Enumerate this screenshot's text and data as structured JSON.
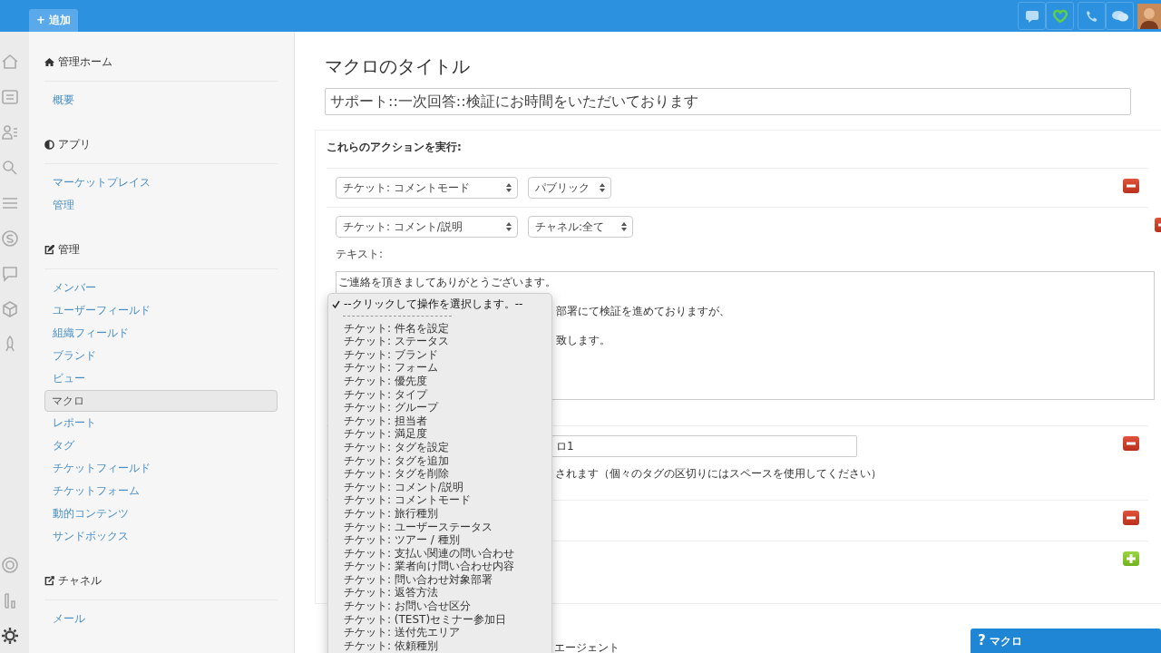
{
  "topbar": {
    "add_button": "+ 追加",
    "icons": [
      {
        "kind": "chat",
        "selected": false
      },
      {
        "kind": "heart",
        "selected": true
      },
      {
        "kind": "phone",
        "selected": false
      },
      {
        "kind": "bubbles",
        "selected": false
      }
    ]
  },
  "rail_top": [
    {
      "kind": "home"
    },
    {
      "kind": "doc"
    },
    {
      "kind": "users"
    },
    {
      "kind": "search"
    },
    {
      "kind": "lines"
    },
    {
      "kind": "s"
    },
    {
      "kind": "chat"
    },
    {
      "kind": "cube"
    },
    {
      "kind": "rocket"
    }
  ],
  "rail_bottom": [
    {
      "kind": "buoy"
    },
    {
      "kind": "bars"
    },
    {
      "kind": "gear"
    }
  ],
  "sidebar": [
    {
      "kind": "home",
      "title": "管理ホーム",
      "items": [
        {
          "label": "概要",
          "selected": false
        }
      ]
    },
    {
      "kind": "half",
      "title": "アプリ",
      "items": [
        {
          "label": "マーケットプレイス",
          "selected": false
        },
        {
          "label": "管理",
          "selected": false
        }
      ]
    },
    {
      "kind": "edit",
      "title": "管理",
      "items": [
        {
          "label": "メンバー",
          "selected": false
        },
        {
          "label": "ユーザーフィールド",
          "selected": false
        },
        {
          "label": "組織フィールド",
          "selected": false
        },
        {
          "label": "ブランド",
          "selected": false
        },
        {
          "label": "ビュー",
          "selected": false
        },
        {
          "label": "マクロ",
          "selected": true
        },
        {
          "label": "レポート",
          "selected": false
        },
        {
          "label": "タグ",
          "selected": false
        },
        {
          "label": "チケットフィールド",
          "selected": false
        },
        {
          "label": "チケットフォーム",
          "selected": false
        },
        {
          "label": "動的コンテンツ",
          "selected": false
        },
        {
          "label": "サンドボックス",
          "selected": false
        }
      ]
    },
    {
      "kind": "share",
      "title": "チャネル",
      "items": [
        {
          "label": "メール",
          "selected": false
        }
      ]
    }
  ],
  "main": {
    "title": "マクロのタイトル",
    "title_value": "サポート::一次回答::検証にお時間をいただいております",
    "actions_heading": "これらのアクションを実行:",
    "actions": [
      {
        "kind": "selects",
        "selects": [
          "チケット: コメントモード",
          "パブリック"
        ],
        "button": {
          "kind": "remove"
        }
      },
      {
        "kind": "comment",
        "selects": [
          "チケット: コメント/説明",
          "チャネル:全て"
        ],
        "text_label": "テキスト:",
        "first_line": "ご連絡を頂きましてありがとうございます。",
        "covered_lines": [
          "部署にて検証を進めておりますが、",
          "致します。"
        ],
        "button": {
          "kind": "remove"
        }
      },
      {
        "kind": "tags",
        "value": "ロ1",
        "hint": "されます（個々のタグの区切りにはスペースを使用してください）",
        "button": {
          "kind": "remove"
        }
      },
      {
        "kind": "empty",
        "button": {
          "kind": "remove"
        }
      },
      {
        "kind": "empty",
        "button": {
          "kind": "add"
        }
      }
    ],
    "footer_text": "エージェント"
  },
  "dropdown": {
    "items": [
      {
        "kind": "option",
        "label": "--クリックして操作を選択します。--",
        "selected": true
      },
      {
        "kind": "separator"
      },
      {
        "kind": "option",
        "label": "チケット: 件名を設定",
        "selected": false
      },
      {
        "kind": "option",
        "label": "チケット: ステータス",
        "selected": false
      },
      {
        "kind": "option",
        "label": "チケット: ブランド",
        "selected": false
      },
      {
        "kind": "option",
        "label": "チケット: フォーム",
        "selected": false
      },
      {
        "kind": "option",
        "label": "チケット: 優先度",
        "selected": false
      },
      {
        "kind": "option",
        "label": "チケット: タイプ",
        "selected": false
      },
      {
        "kind": "option",
        "label": "チケット: グループ",
        "selected": false
      },
      {
        "kind": "option",
        "label": "チケット: 担当者",
        "selected": false
      },
      {
        "kind": "option",
        "label": "チケット: 満足度",
        "selected": false
      },
      {
        "kind": "option",
        "label": "チケット: タグを設定",
        "selected": false
      },
      {
        "kind": "option",
        "label": "チケット: タグを追加",
        "selected": false
      },
      {
        "kind": "option",
        "label": "チケット: タグを削除",
        "selected": false
      },
      {
        "kind": "option",
        "label": "チケット: コメント/説明",
        "selected": false
      },
      {
        "kind": "option",
        "label": "チケット: コメントモード",
        "selected": false
      },
      {
        "kind": "option",
        "label": "チケット: 旅行種別",
        "selected": false
      },
      {
        "kind": "option",
        "label": "チケット: ユーザーステータス",
        "selected": false
      },
      {
        "kind": "option",
        "label": "チケット: ツアー / 種別",
        "selected": false
      },
      {
        "kind": "option",
        "label": "チケット: 支払い関連の問い合わせ",
        "selected": false
      },
      {
        "kind": "option",
        "label": "チケット: 業者向け問い合わせ内容",
        "selected": false
      },
      {
        "kind": "option",
        "label": "チケット: 問い合わせ対象部署",
        "selected": false
      },
      {
        "kind": "option",
        "label": "チケット: 返答方法",
        "selected": false
      },
      {
        "kind": "option",
        "label": "チケット: お問い合せ区分",
        "selected": false
      },
      {
        "kind": "option",
        "label": "チケット: (TEST)セミナー参加日",
        "selected": false
      },
      {
        "kind": "option",
        "label": "チケット: 送付先エリア",
        "selected": false
      },
      {
        "kind": "option",
        "label": "チケット: 依頼種別",
        "selected": false
      }
    ]
  },
  "help_widget": {
    "icon": "?",
    "label": "マクロ"
  }
}
